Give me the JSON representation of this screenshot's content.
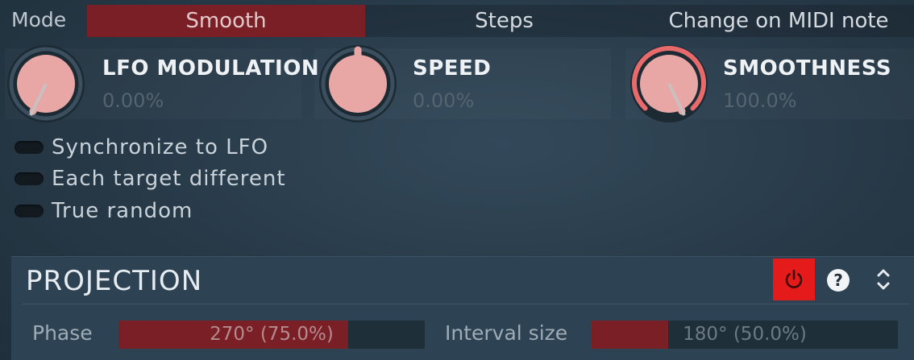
{
  "mode": {
    "label": "Mode",
    "options": [
      "Smooth",
      "Steps",
      "Change on MIDI note"
    ],
    "selected": 0
  },
  "knobs": [
    {
      "name": "LFO MODULATION",
      "value": "0.00%",
      "fraction": 0.0
    },
    {
      "name": "SPEED",
      "value": "0.00%",
      "fraction": 0.5
    },
    {
      "name": "SMOOTHNESS",
      "value": "100.0%",
      "fraction": 1.0
    }
  ],
  "switches": [
    {
      "label": "Synchronize to LFO",
      "on": false
    },
    {
      "label": "Each target different",
      "on": false
    },
    {
      "label": "True random",
      "on": false
    }
  ],
  "projection": {
    "title": "PROJECTION",
    "help": "?",
    "phase": {
      "label": "Phase",
      "value": "270° (75.0%)",
      "fraction": 0.75
    },
    "interval": {
      "label": "Interval size",
      "value": "180° (50.0%)",
      "fraction": 0.25
    }
  },
  "colors": {
    "accent": "#7a1f25",
    "power": "#e51b1b",
    "knob": "#e8a7a5",
    "ring_active": "#e86a6a"
  },
  "icons": [
    "power-icon",
    "help-icon",
    "expand-collapse-icon"
  ]
}
